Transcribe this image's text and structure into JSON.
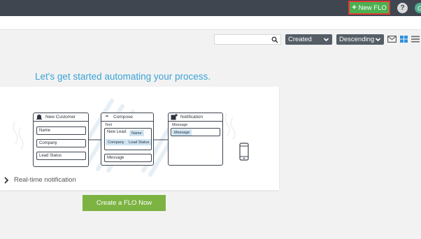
{
  "topbar": {
    "new_flo_label": "New FLO",
    "help_label": "?",
    "avatar_initial": "G"
  },
  "toolbar": {
    "search_value": "",
    "sort_field": "Created",
    "sort_order": "Descending"
  },
  "main": {
    "heading": "Let's get started automating your process.",
    "illustration": {
      "card1": {
        "title": "New Customer",
        "fields": [
          "Name",
          "Company",
          "Lead Status"
        ]
      },
      "card2": {
        "title": "Compose",
        "text_label": "Text",
        "new_lead_label": "New Lead:",
        "chips": [
          "Name",
          "Company",
          "Lead Status"
        ],
        "message_field": "Message"
      },
      "card3": {
        "title": "Notification",
        "message_label": "Message",
        "message_chip": "Message"
      }
    },
    "realtime_label": "Real-time notification",
    "create_button_label": "Create a FLO Now"
  },
  "colors": {
    "topbar": "#3f4650",
    "new_flo_button": "#4caf50",
    "heading": "#3aa3d6",
    "create_button": "#7cb342",
    "select_bg": "#555d66",
    "grid_icon_active": "#2f8fd8"
  }
}
